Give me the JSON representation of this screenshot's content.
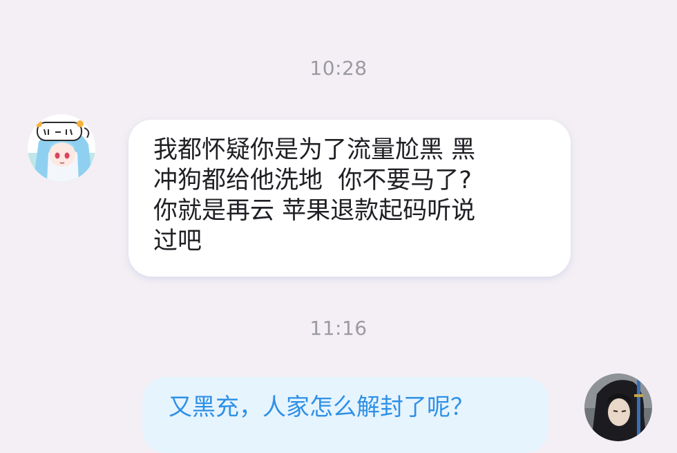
{
  "chat": {
    "timestamps": [
      "10:28",
      "11:16"
    ],
    "messages": [
      {
        "sender": "other",
        "avatar_icon": "anime-girl-avatar-icon",
        "text": "我都怀疑你是为了流量尬黑 黑\n冲狗都给他洗地  你不要马了?\n你就是再云 苹果退款起码听说\n过吧"
      },
      {
        "sender": "self",
        "avatar_icon": "swordsman-avatar-icon",
        "text": "又黑充，人家怎么解封了呢？"
      }
    ]
  },
  "colors": {
    "background": "#f4eff4",
    "received_bubble": "#ffffff",
    "sent_bubble": "#e6f4fe",
    "sent_text": "#2e90e6",
    "timestamp_text": "#9a9aa2"
  }
}
